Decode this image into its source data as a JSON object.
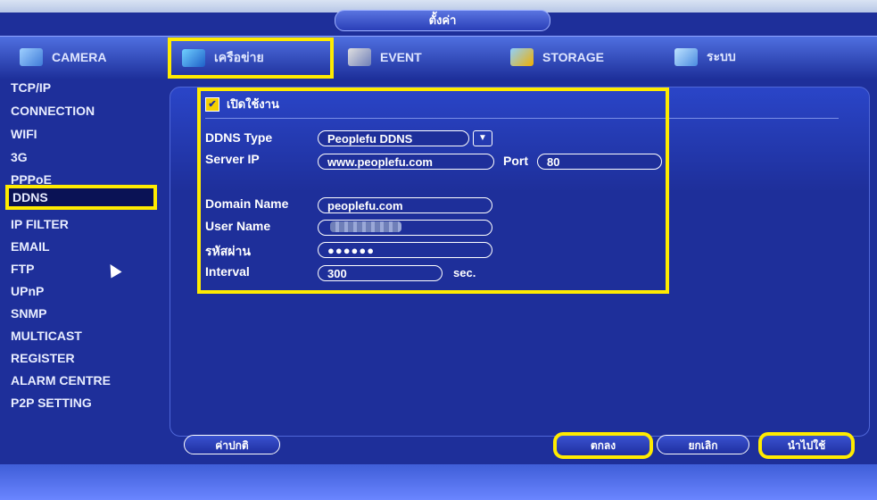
{
  "window": {
    "title": "ตั้งค่า"
  },
  "tabs": [
    {
      "label": "CAMERA",
      "icon": "camera-icon"
    },
    {
      "label": "เครือข่าย",
      "icon": "network-icon"
    },
    {
      "label": "EVENT",
      "icon": "event-icon"
    },
    {
      "label": "STORAGE",
      "icon": "storage-icon"
    },
    {
      "label": "ระบบ",
      "icon": "system-icon"
    }
  ],
  "sidebar": {
    "items": [
      "TCP/IP",
      "CONNECTION",
      "WIFI",
      "3G",
      "PPPoE",
      "DDNS",
      "IP FILTER",
      "EMAIL",
      "FTP",
      "UPnP",
      "SNMP",
      "MULTICAST",
      "REGISTER",
      "ALARM CENTRE",
      "P2P SETTING"
    ],
    "active": "DDNS"
  },
  "ddns": {
    "enable_label": "เปิดใช้งาน",
    "enabled": true,
    "ddns_type_label": "DDNS Type",
    "ddns_type_value": "Peoplefu DDNS",
    "server_ip_label": "Server IP",
    "server_ip_value": "www.peoplefu.com",
    "port_label": "Port",
    "port_value": "80",
    "domain_name_label": "Domain Name",
    "domain_name_value": "peoplefu.com",
    "user_name_label": "User Name",
    "password_label": "รหัสผ่าน",
    "password_value": "●●●●●●",
    "interval_label": "Interval",
    "interval_value": "300",
    "interval_unit": "sec."
  },
  "buttons": {
    "default": "ค่าปกติ",
    "ok": "ตกลง",
    "cancel": "ยกเลิก",
    "apply": "นำไปใช้"
  },
  "colors": {
    "highlight": "#ffeb00",
    "background": "#1e2f9a"
  }
}
